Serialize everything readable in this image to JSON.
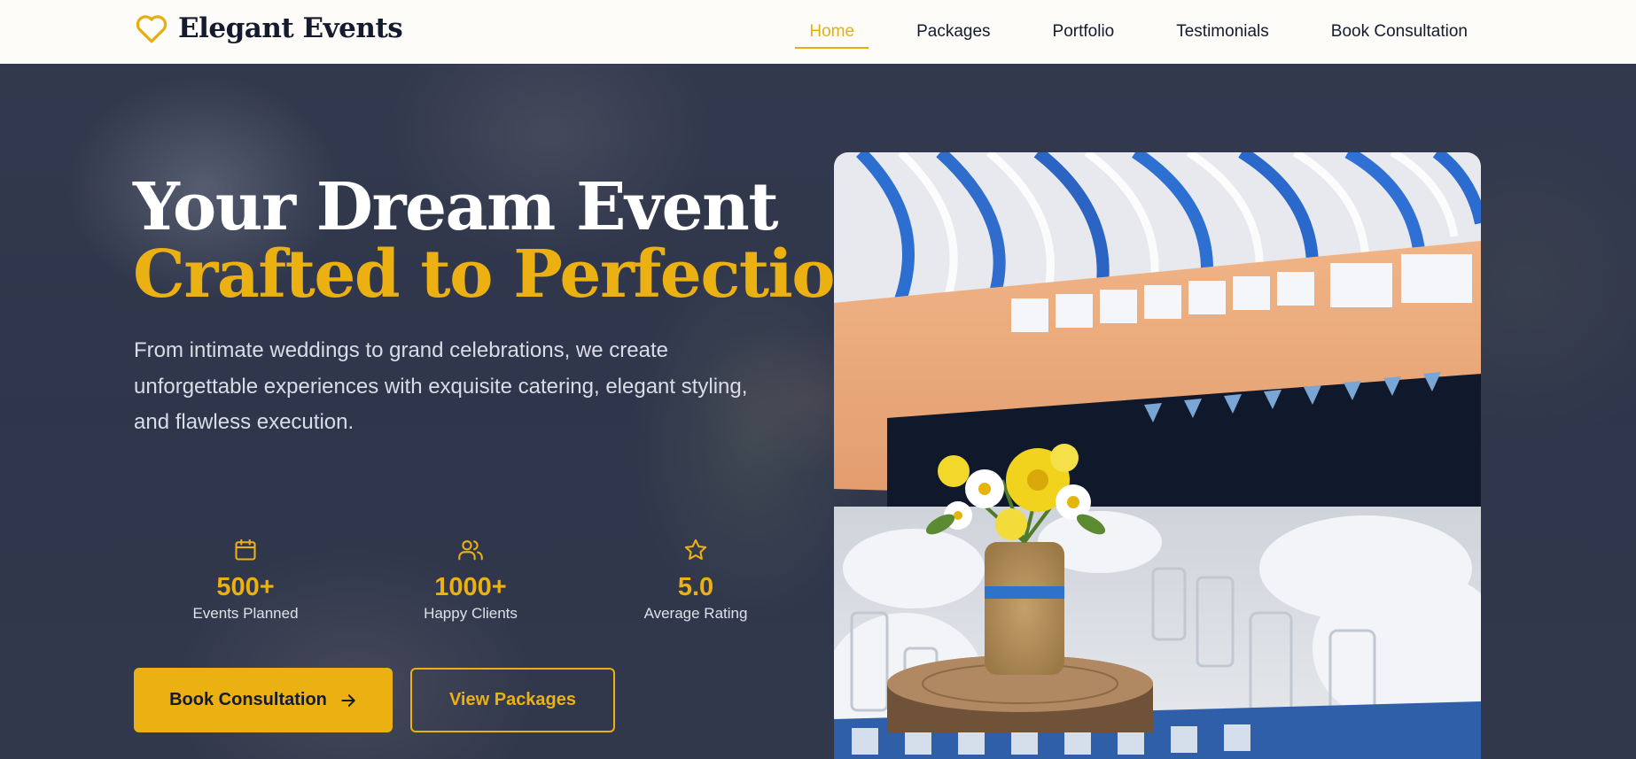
{
  "header": {
    "logo_text": "Elegant Events",
    "nav": [
      {
        "label": "Home",
        "active": true
      },
      {
        "label": "Packages",
        "active": false
      },
      {
        "label": "Portfolio",
        "active": false
      },
      {
        "label": "Testimonials",
        "active": false
      },
      {
        "label": "Book Consultation",
        "active": false
      }
    ]
  },
  "hero": {
    "title_line1": "Your Dream Event",
    "title_line2": "Crafted to Perfection",
    "description": "From intimate weddings to grand celebrations, we create unforgettable experiences with exquisite catering, elegant styling, and flawless execution.",
    "stats": [
      {
        "icon": "calendar-icon",
        "value": "500+",
        "label": "Events Planned"
      },
      {
        "icon": "users-icon",
        "value": "1000+",
        "label": "Happy Clients"
      },
      {
        "icon": "star-icon",
        "value": "5.0",
        "label": "Average Rating"
      }
    ],
    "primary_button": "Book Consultation",
    "secondary_button": "View Packages"
  },
  "colors": {
    "accent": "#ebb012",
    "dark_text": "#151b2e",
    "header_bg": "#fdfcf8"
  }
}
